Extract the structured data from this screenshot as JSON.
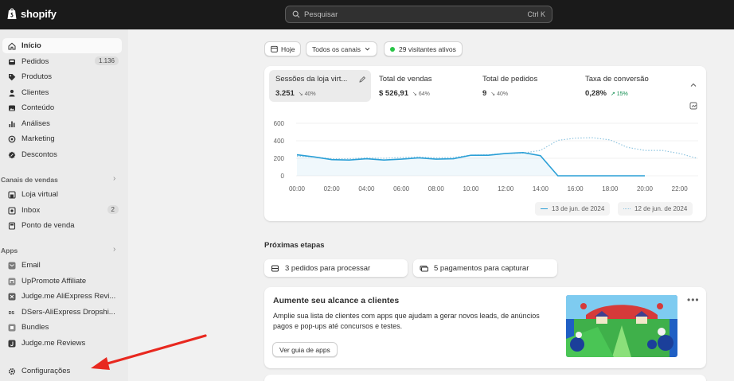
{
  "header": {
    "brand": "shopify",
    "search_placeholder": "Pesquisar",
    "shortcut": "Ctrl K"
  },
  "sidebar": {
    "main_items": [
      {
        "label": "Início",
        "icon": "home-icon",
        "active": true
      },
      {
        "label": "Pedidos",
        "icon": "inbox-icon",
        "badge": "1.136"
      },
      {
        "label": "Produtos",
        "icon": "tag-icon"
      },
      {
        "label": "Clientes",
        "icon": "person-icon"
      },
      {
        "label": "Conteúdo",
        "icon": "image-icon"
      },
      {
        "label": "Análises",
        "icon": "bar-chart-icon"
      },
      {
        "label": "Marketing",
        "icon": "target-icon"
      },
      {
        "label": "Descontos",
        "icon": "discount-icon"
      }
    ],
    "sales_channels_label": "Canais de vendas",
    "sales_channels": [
      {
        "label": "Loja virtual",
        "icon": "store-icon"
      },
      {
        "label": "Inbox",
        "icon": "chat-icon",
        "badge": "2"
      },
      {
        "label": "Ponto de venda",
        "icon": "pos-icon"
      }
    ],
    "apps_label": "Apps",
    "apps": [
      {
        "label": "Email",
        "icon": "email-app-icon"
      },
      {
        "label": "UpPromote Affiliate",
        "icon": "uppromote-app-icon"
      },
      {
        "label": "Judge.me AliExpress Revi...",
        "icon": "judgeme-x-app-icon"
      },
      {
        "label": "DSers-AliExpress Dropshi...",
        "icon": "dsers-app-icon"
      },
      {
        "label": "Bundles",
        "icon": "bundles-app-icon"
      },
      {
        "label": "Judge.me Reviews",
        "icon": "judgeme-app-icon"
      }
    ],
    "settings_label": "Configurações",
    "settings_icon": "gear-icon"
  },
  "filters": {
    "date": "Hoje",
    "channels": "Todos os canais",
    "visitors": "29 visitantes ativos"
  },
  "metrics": [
    {
      "label": "Sessões da loja virt...",
      "value": "3.251",
      "delta": "40%",
      "direction": "down"
    },
    {
      "label": "Total de vendas",
      "value": "$ 526,91",
      "delta": "64%",
      "direction": "down"
    },
    {
      "label": "Total de pedidos",
      "value": "9",
      "delta": "40%",
      "direction": "down"
    },
    {
      "label": "Taxa de conversão",
      "value": "0,28%",
      "delta": "15%",
      "direction": "up"
    }
  ],
  "chart_data": {
    "type": "line",
    "x": [
      "00:00",
      "01:00",
      "02:00",
      "03:00",
      "04:00",
      "05:00",
      "06:00",
      "07:00",
      "08:00",
      "09:00",
      "10:00",
      "11:00",
      "12:00",
      "13:00",
      "14:00",
      "15:00",
      "16:00",
      "17:00",
      "18:00",
      "19:00",
      "20:00",
      "21:00",
      "22:00",
      "23:00"
    ],
    "x_ticks": [
      "00:00",
      "02:00",
      "04:00",
      "06:00",
      "08:00",
      "10:00",
      "12:00",
      "14:00",
      "16:00",
      "18:00",
      "20:00",
      "22:00"
    ],
    "y_ticks": [
      600,
      400,
      200,
      0
    ],
    "ylim": [
      0,
      600
    ],
    "series": [
      {
        "name": "13 de jun. de 2024",
        "style": "solid",
        "color": "#2a9fd6",
        "values": [
          240,
          215,
          185,
          180,
          195,
          180,
          190,
          205,
          190,
          195,
          235,
          235,
          255,
          265,
          230,
          0,
          0,
          0,
          0,
          0,
          0
        ]
      },
      {
        "name": "12 de jun. de 2024",
        "style": "dotted",
        "color": "#8fc5e0",
        "values": [
          225,
          215,
          195,
          195,
          205,
          200,
          210,
          215,
          205,
          210,
          235,
          240,
          255,
          260,
          290,
          405,
          430,
          435,
          410,
          325,
          290,
          290,
          255,
          200
        ]
      }
    ],
    "title": "",
    "xlabel": "",
    "ylabel": "",
    "legend_position": "bottom-right",
    "grid": true
  },
  "next_steps": {
    "title": "Próximas etapas",
    "tasks": [
      {
        "label": "3 pedidos para processar",
        "icon": "order-box-icon"
      },
      {
        "label": "5 pagamentos para capturar",
        "icon": "payments-icon"
      }
    ]
  },
  "promo": {
    "title": "Aumente seu alcance a clientes",
    "text": "Amplie sua lista de clientes com apps que ajudam a gerar novos leads, de anúncios pagos e pop-ups até concursos e testes.",
    "button": "Ver guia de apps"
  }
}
